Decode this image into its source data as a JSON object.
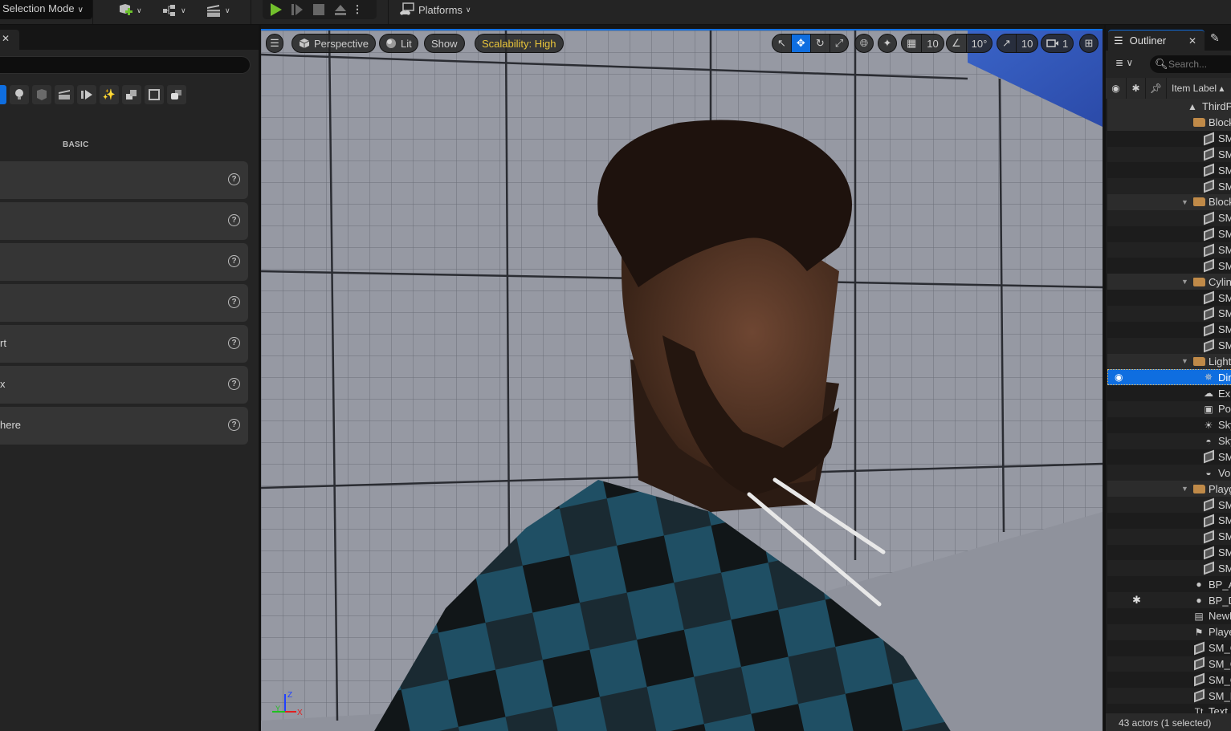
{
  "toolbar": {
    "mode_label": "Selection Mode",
    "platforms_label": "Platforms",
    "icons": [
      "add-actor-icon",
      "blueprint-icon",
      "cinematics-icon",
      "play-icon",
      "step-icon",
      "stop-icon",
      "eject-icon",
      "more-icon",
      "platforms-icon"
    ]
  },
  "left_panel": {
    "category_label": "BASIC",
    "items": [
      {
        "label": ""
      },
      {
        "label": ""
      },
      {
        "label": ""
      },
      {
        "label": ""
      },
      {
        "label": "rt"
      },
      {
        "label": "x"
      },
      {
        "label": "here"
      }
    ]
  },
  "viewport": {
    "perspective_label": "Perspective",
    "lit_label": "Lit",
    "show_label": "Show",
    "scalability_label": "Scalability: High",
    "grid_snap_value": "10",
    "rotation_snap_value": "10°",
    "scale_snap_value": "10",
    "camera_speed_value": "1",
    "axis_labels": {
      "z": "Z",
      "y": "Y",
      "x": "X"
    },
    "colors": {
      "accent": "#0f6ee0",
      "scalability": "#e8c43a",
      "axis_x": "#e02020",
      "axis_y": "#20c020",
      "axis_z": "#2040ff"
    }
  },
  "outliner": {
    "tab_label": "Outliner",
    "search_placeholder": "Search...",
    "column_label": "Item Label",
    "rows": [
      {
        "label": "ThirdP",
        "icon": "level-icon",
        "indent": 1,
        "type": "level"
      },
      {
        "label": "Block",
        "icon": "folder-icon",
        "indent": 2,
        "type": "folder"
      },
      {
        "label": "SM",
        "icon": "mesh-icon",
        "indent": 3
      },
      {
        "label": "SM",
        "icon": "mesh-icon",
        "indent": 3
      },
      {
        "label": "SM",
        "icon": "mesh-icon",
        "indent": 3
      },
      {
        "label": "SM",
        "icon": "mesh-icon",
        "indent": 3
      },
      {
        "label": "Block",
        "icon": "folder-icon",
        "indent": 2,
        "type": "folder",
        "expanded": true
      },
      {
        "label": "SM",
        "icon": "mesh-icon",
        "indent": 3
      },
      {
        "label": "SM",
        "icon": "mesh-icon",
        "indent": 3
      },
      {
        "label": "SM",
        "icon": "mesh-icon",
        "indent": 3
      },
      {
        "label": "SM",
        "icon": "mesh-icon",
        "indent": 3
      },
      {
        "label": "Cylin",
        "icon": "folder-icon",
        "indent": 2,
        "type": "folder",
        "expanded": true
      },
      {
        "label": "SM",
        "icon": "mesh-icon",
        "indent": 3
      },
      {
        "label": "SM",
        "icon": "mesh-icon",
        "indent": 3
      },
      {
        "label": "SM",
        "icon": "mesh-icon",
        "indent": 3
      },
      {
        "label": "SM",
        "icon": "mesh-icon",
        "indent": 3
      },
      {
        "label": "Light",
        "icon": "folder-icon",
        "indent": 2,
        "type": "folder",
        "expanded": true
      },
      {
        "label": "Dir",
        "icon": "directional-light-icon",
        "indent": 3,
        "selected": true
      },
      {
        "label": "Exp",
        "icon": "exponential-fog-icon",
        "indent": 3
      },
      {
        "label": "Po",
        "icon": "post-process-icon",
        "indent": 3
      },
      {
        "label": "Sky",
        "icon": "sky-atmosphere-icon",
        "indent": 3
      },
      {
        "label": "Sky",
        "icon": "sky-light-icon",
        "indent": 3
      },
      {
        "label": "SM",
        "icon": "mesh-icon",
        "indent": 3
      },
      {
        "label": "Vo",
        "icon": "volumetric-cloud-icon",
        "indent": 3
      },
      {
        "label": "Playg",
        "icon": "folder-icon",
        "indent": 2,
        "type": "folder",
        "expanded": true
      },
      {
        "label": "SM",
        "icon": "mesh-icon",
        "indent": 3
      },
      {
        "label": "SM",
        "icon": "mesh-icon",
        "indent": 3
      },
      {
        "label": "SM",
        "icon": "mesh-icon",
        "indent": 3
      },
      {
        "label": "SM",
        "icon": "mesh-icon",
        "indent": 3
      },
      {
        "label": "SM",
        "icon": "mesh-icon",
        "indent": 3
      },
      {
        "label": "BP_A",
        "icon": "pawn-icon",
        "indent": 2
      },
      {
        "label": "BP_D",
        "icon": "pawn-icon",
        "indent": 2,
        "starred": true
      },
      {
        "label": "NewL",
        "icon": "sequence-icon",
        "indent": 2
      },
      {
        "label": "Playe",
        "icon": "player-start-icon",
        "indent": 2
      },
      {
        "label": "SM_C",
        "icon": "mesh-icon",
        "indent": 2
      },
      {
        "label": "SM_C",
        "icon": "mesh-icon",
        "indent": 2
      },
      {
        "label": "SM_C",
        "icon": "mesh-icon",
        "indent": 2
      },
      {
        "label": "SM_R",
        "icon": "mesh-icon",
        "indent": 2
      },
      {
        "label": "Text",
        "icon": "text-render-icon",
        "indent": 2
      }
    ],
    "status": "43 actors (1 selected)"
  }
}
